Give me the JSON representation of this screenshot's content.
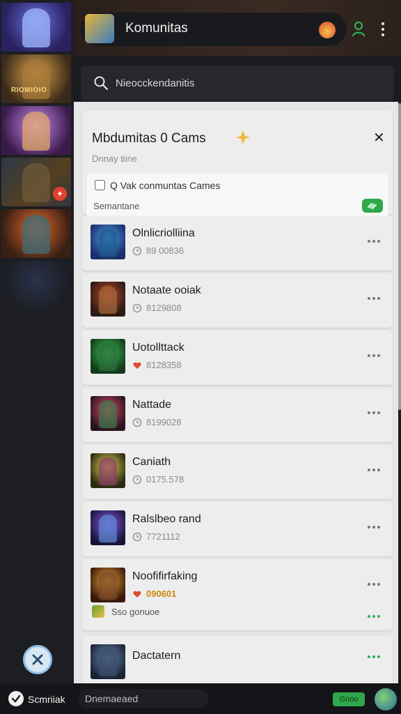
{
  "header": {
    "title": "Komunitas"
  },
  "search": {
    "placeholder": "Nieocckendanitis"
  },
  "dialog": {
    "title": "Mbdumitas 0 Cams",
    "subtitle": "Dnnay tiine",
    "checkbox_label": "Q Vak conmuntas Cames",
    "footer_label": "Semantane"
  },
  "communities": [
    {
      "title": "Olnlicriolliina",
      "meta": "89 00836",
      "meta_icon": "clock-icon"
    },
    {
      "title": "Notaate ooiak",
      "meta": "8129808",
      "meta_icon": "clock-icon"
    },
    {
      "title": "Uotollttack",
      "meta": "8128358",
      "meta_icon": "heart-icon"
    },
    {
      "title": "Nattade",
      "meta": "8199028",
      "meta_icon": "clock-icon"
    },
    {
      "title": "Caniath",
      "meta": "0175.578",
      "meta_icon": "clock-icon"
    },
    {
      "title": "Ralslbeo rand",
      "meta": "7721112",
      "meta_icon": "clock-icon"
    },
    {
      "title": "Noofifirfaking",
      "meta": "090601",
      "meta_icon": "heart-icon",
      "extra": "Sso gonuoe"
    },
    {
      "title": "Dactatern",
      "meta": "",
      "meta_icon": "heart-icon"
    }
  ],
  "bottom_bar": {
    "label": "Scmriiak",
    "field_text": "Dnemaeaed",
    "button_label": "Gnoo"
  },
  "colors": {
    "accent_green": "#2ea84c",
    "panel_bg": "#e6e6e6",
    "dark_bg": "#1b1c20"
  }
}
